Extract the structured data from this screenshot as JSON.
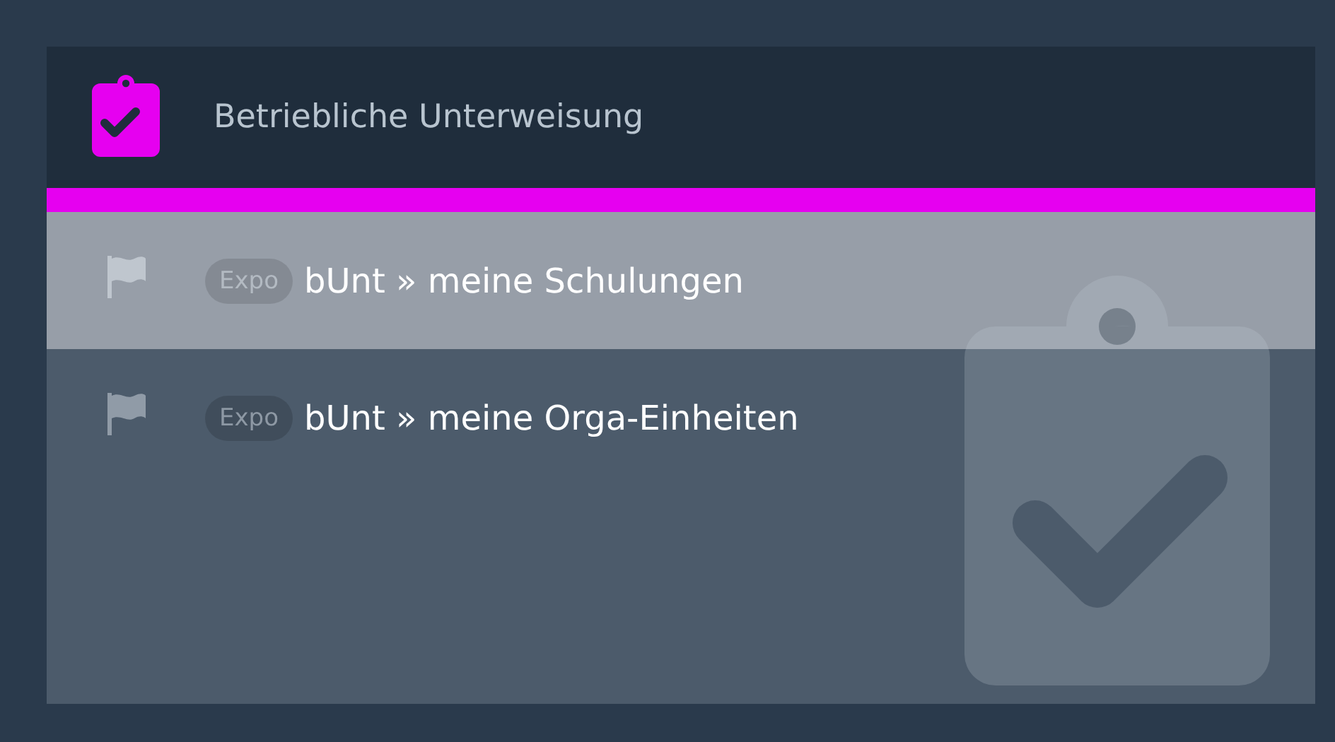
{
  "card": {
    "title": "Betriebliche Unterweisung",
    "items": [
      {
        "badge": "Expo",
        "label": "bUnt » meine Schulungen",
        "selected": true
      },
      {
        "badge": "Expo",
        "label": "bUnt » meine Orga-Einheiten",
        "selected": false
      }
    ]
  }
}
